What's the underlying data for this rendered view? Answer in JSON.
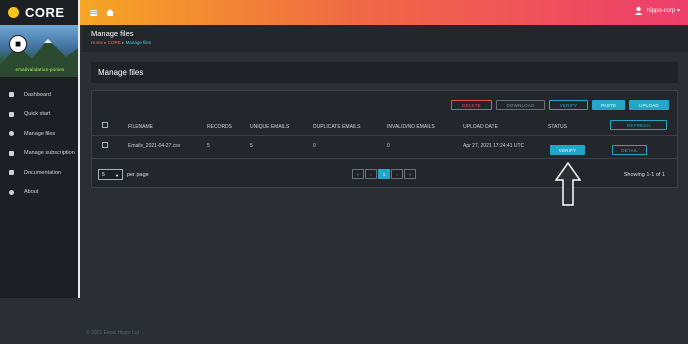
{
  "app": {
    "brand": "CORE",
    "banner_text": "emailvalidation-ponies"
  },
  "sidebar": {
    "items": [
      {
        "label": "Dashboard",
        "icon": "dashboard-icon"
      },
      {
        "label": "Quick start",
        "icon": "bolt-icon"
      },
      {
        "label": "Manage files",
        "icon": "file-icon"
      },
      {
        "label": "Manage subscription",
        "icon": "card-icon"
      },
      {
        "label": "Documentation",
        "icon": "book-icon"
      },
      {
        "label": "About",
        "icon": "info-icon"
      }
    ]
  },
  "topbar": {
    "user": "hippo-corp ▾"
  },
  "header": {
    "title": "Manage files",
    "crumbs": [
      "Home",
      "CORE",
      "Manage files"
    ]
  },
  "card": {
    "title": "Manage files"
  },
  "toolbar": {
    "delete": "DELETE",
    "download": "DOWNLOAD",
    "verify": "VERIFY",
    "paste": "PASTE",
    "upload": "UPLOAD",
    "refresh": "REFRESH"
  },
  "table": {
    "columns": [
      "FILENAME",
      "RECORDS",
      "UNIQUE EMAILS",
      "DUPLICATE EMAILS",
      "INVALID/NO EMAILS",
      "UPLOAD DATE",
      "STATUS"
    ],
    "rows": [
      {
        "filename": "Emails_2021-04-27.csv",
        "records": "5",
        "unique": "5",
        "duplicate": "0",
        "invalid": "0",
        "date": "Apr 27, 2021 17:24:41 UTC",
        "status_button": "VERIFY",
        "detail_button": "DETAIL"
      }
    ]
  },
  "pagination": {
    "per_page_value": "5",
    "per_page_label": "per page",
    "pages": [
      "«",
      "‹",
      "1",
      "›",
      "»"
    ],
    "active_page": "1",
    "showing": "Showing 1-1 of 1"
  },
  "footer": {
    "text": "© 2021 Email Hippo Ltd"
  },
  "colors": {
    "accent": "#22a7c9",
    "danger": "#e0514f",
    "topbar_start": "#f5a623",
    "topbar_end": "#ee3e6c"
  }
}
